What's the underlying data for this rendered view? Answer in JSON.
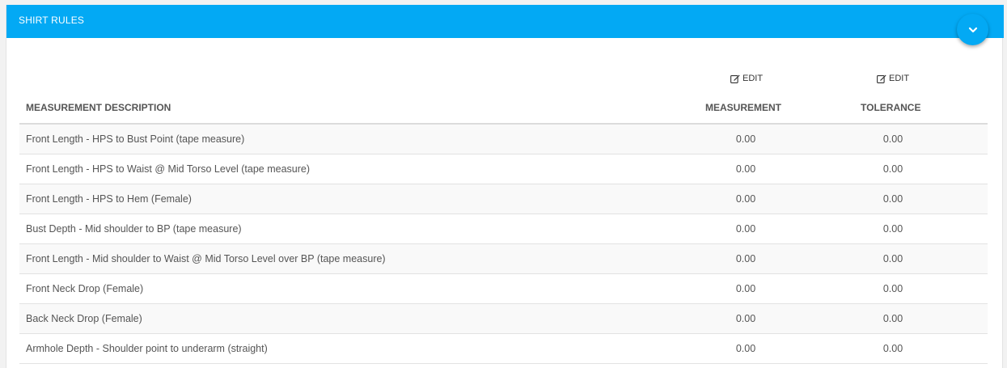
{
  "panel": {
    "title": "SHIRT RULES",
    "accent_color": "#03a9f4",
    "collapse_icon": "chevron-down-icon"
  },
  "edit_links": {
    "measurement_label": "EDIT",
    "tolerance_label": "EDIT",
    "icon": "edit-icon"
  },
  "columns": {
    "description": "MEASUREMENT DESCRIPTION",
    "measurement": "MEASUREMENT",
    "tolerance": "TOLERANCE"
  },
  "rows": [
    {
      "description": "Front Length - HPS to Bust Point (tape measure)",
      "measurement": "0.00",
      "tolerance": "0.00"
    },
    {
      "description": "Front Length - HPS to Waist @ Mid Torso Level (tape measure)",
      "measurement": "0.00",
      "tolerance": "0.00"
    },
    {
      "description": "Front Length - HPS to Hem (Female)",
      "measurement": "0.00",
      "tolerance": "0.00"
    },
    {
      "description": "Bust Depth - Mid shoulder to BP (tape measure)",
      "measurement": "0.00",
      "tolerance": "0.00"
    },
    {
      "description": "Front Length - Mid shoulder to Waist @ Mid Torso Level over BP (tape measure)",
      "measurement": "0.00",
      "tolerance": "0.00"
    },
    {
      "description": "Front Neck Drop (Female)",
      "measurement": "0.00",
      "tolerance": "0.00"
    },
    {
      "description": "Back Neck Drop (Female)",
      "measurement": "0.00",
      "tolerance": "0.00"
    },
    {
      "description": "Armhole Depth - Shoulder point to underarm (straight)",
      "measurement": "0.00",
      "tolerance": "0.00"
    }
  ]
}
